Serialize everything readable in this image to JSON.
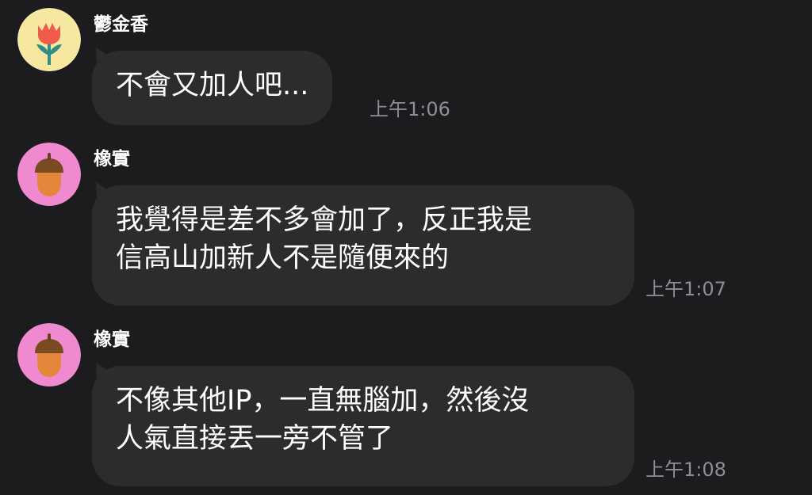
{
  "messages": [
    {
      "sender": "鬱金香",
      "avatar_icon": "tulip-icon",
      "avatar_bg": "#f6e7a1",
      "lines": [
        "不會又加人吧..."
      ],
      "time": "上午1:06"
    },
    {
      "sender": "橡實",
      "avatar_icon": "acorn-icon",
      "avatar_bg": "#f08ad0",
      "lines": [
        "我覺得是差不多會加了，反正我是",
        "信高山加新人不是隨便來的"
      ],
      "time": "上午1:07"
    },
    {
      "sender": "橡實",
      "avatar_icon": "acorn-icon",
      "avatar_bg": "#f08ad0",
      "lines": [
        "不像其他IP，一直無腦加，然後沒",
        "人氣直接丟一旁不管了"
      ],
      "time": "上午1:08"
    }
  ],
  "colors": {
    "background": "#1c1c1e",
    "bubble": "#2c2c2e",
    "text": "#ffffff",
    "timestamp": "#8e8e93"
  }
}
